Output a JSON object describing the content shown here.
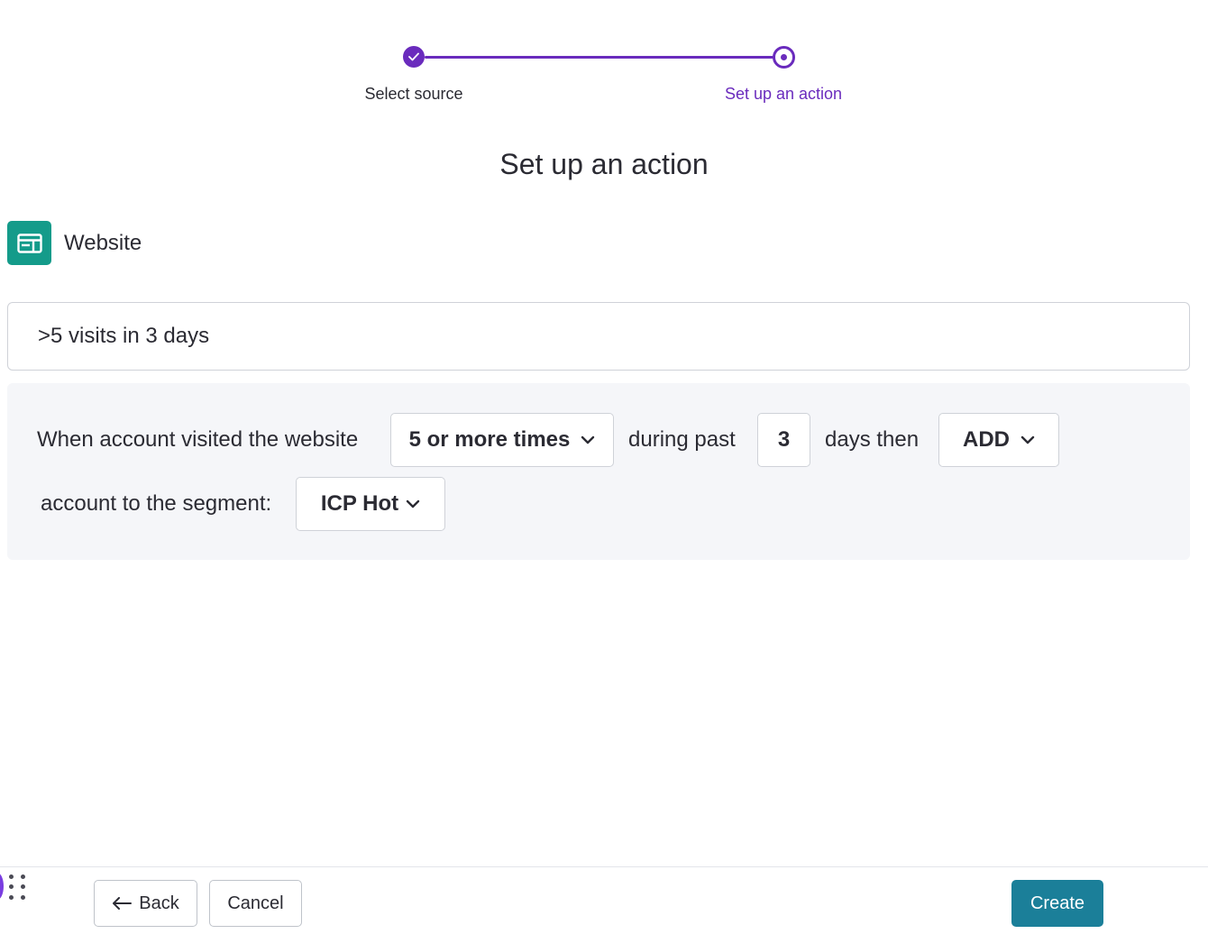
{
  "stepper": {
    "steps": [
      {
        "label": "Select source",
        "state": "done"
      },
      {
        "label": "Set up an action",
        "state": "current"
      }
    ],
    "accent_color": "#6a2bbd"
  },
  "page": {
    "title": "Set up an action"
  },
  "source": {
    "name": "Website",
    "icon": "browser-window-icon",
    "icon_color": "#149b8a"
  },
  "action_name": {
    "value": ">5 visits in 3 days"
  },
  "rule": {
    "prefix": "When account visited the website",
    "frequency": {
      "selected": "5 or more times"
    },
    "mid_text": "during past",
    "days": {
      "value": "3"
    },
    "then_text": "days then",
    "operation": {
      "selected": "ADD"
    },
    "segment_text": "account to the segment:",
    "segment": {
      "selected": "ICP Hot"
    }
  },
  "footer": {
    "back_label": "Back",
    "cancel_label": "Cancel",
    "create_label": "Create",
    "primary_color": "#1b7f99"
  }
}
